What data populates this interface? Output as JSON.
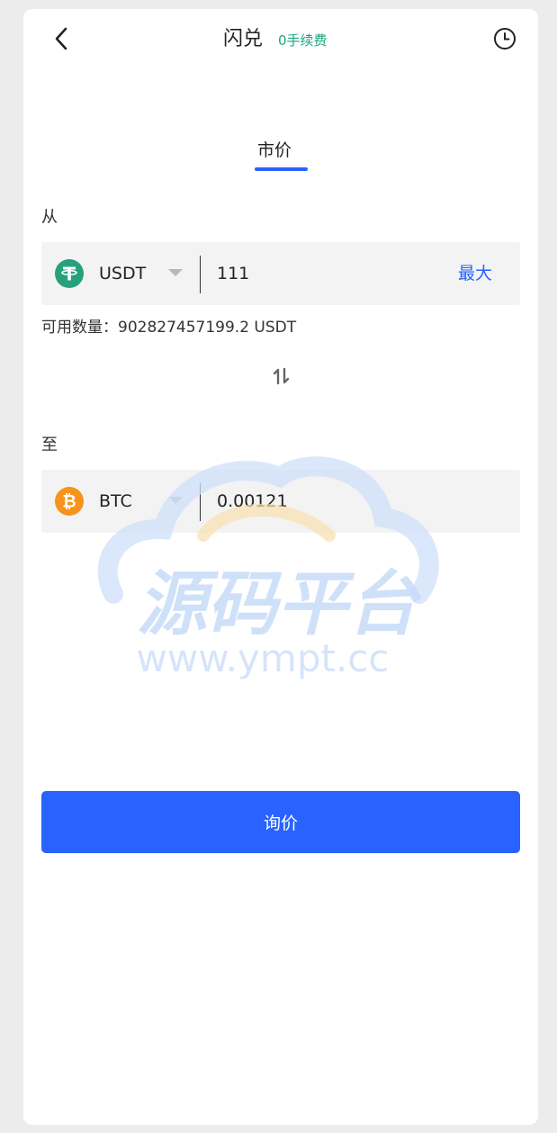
{
  "header": {
    "title": "闪兑",
    "fee_badge": "0手续费",
    "back_icon": "chevron-left-icon",
    "history_icon": "clock-icon"
  },
  "tabs": [
    {
      "label": "市价",
      "active": true
    }
  ],
  "from": {
    "label": "从",
    "coin": "USDT",
    "coin_icon": "tether-icon",
    "coin_color": "#26a17b",
    "amount": "111",
    "max_label": "最大"
  },
  "available": {
    "text": "可用数量：902827457199.2 USDT"
  },
  "swap_icon": "swap-vertical-icon",
  "to": {
    "label": "至",
    "coin": "BTC",
    "coin_icon": "bitcoin-icon",
    "coin_color": "#f7931a",
    "amount": "0.00121"
  },
  "action": {
    "quote_label": "询价"
  },
  "watermark": {
    "title": "源码平台",
    "url": "www.ympt.cc"
  },
  "colors": {
    "accent": "#2962ff",
    "fee_green": "#19a77e",
    "field_bg": "#f3f3f3"
  }
}
